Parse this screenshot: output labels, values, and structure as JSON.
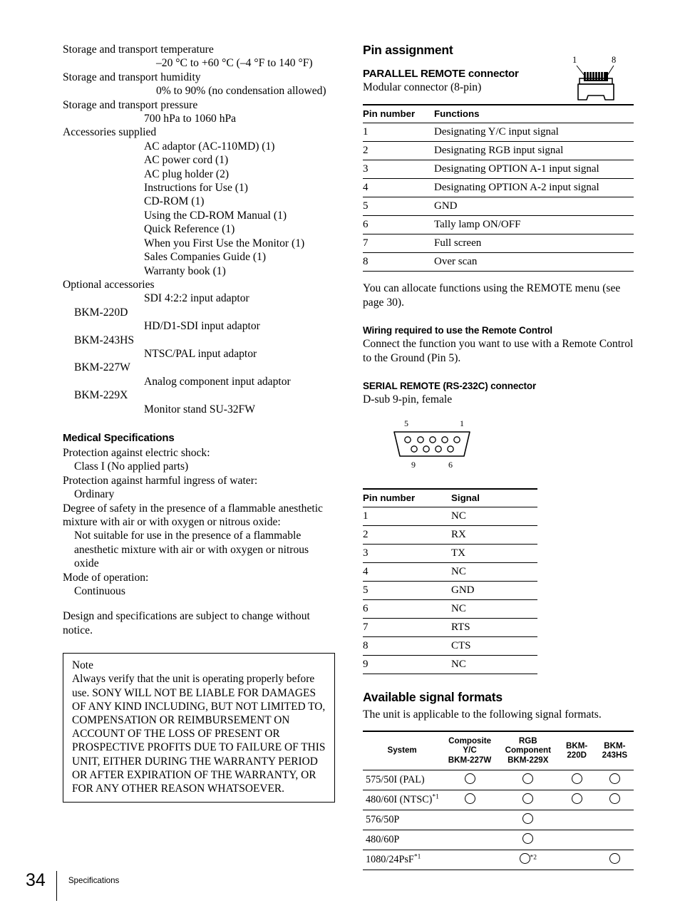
{
  "page": {
    "number": "34",
    "chapter": "Specifications"
  },
  "left_column": {
    "spec_items": [
      {
        "label": "Storage and transport temperature",
        "values": [
          "–20 °C to +60 °C (–4 °F to 140 °F)"
        ]
      },
      {
        "label": "Storage and transport humidity",
        "values": [
          "0% to 90% (no condensation allowed)"
        ]
      },
      {
        "label": "Storage and transport pressure",
        "values": [
          "700 hPa to 1060 hPa"
        ]
      },
      {
        "label": "Accessories supplied",
        "values": [
          "AC adaptor (AC-110MD) (1)",
          "AC power cord (1)",
          "AC plug holder (2)",
          "Instructions for Use (1)",
          "CD-ROM (1)",
          "Using the CD-ROM Manual (1)",
          "Quick Reference (1)",
          "When you First Use the Monitor (1)",
          "Sales Companies Guide (1)",
          "Warranty book (1)"
        ]
      },
      {
        "label": "Optional accessories",
        "values": [
          "SDI 4:2:2 input adaptor",
          "BKM-220D",
          "HD/D1-SDI input adaptor",
          "BKM-243HS",
          "NTSC/PAL input adaptor",
          "BKM-227W",
          "Analog component input adaptor",
          "BKM-229X",
          "Monitor stand SU-32FW"
        ]
      }
    ],
    "medical": {
      "heading": "Medical Specifications",
      "entries": [
        {
          "label": "Protection against electric shock:",
          "value": "Class I (No applied parts)"
        },
        {
          "label": "Protection against harmful ingress of water:",
          "value": "Ordinary"
        },
        {
          "label": "Degree of safety in the presence of a flammable anesthetic mixture with air or with oxygen or nitrous oxide:",
          "value": "Not suitable for use in the presence of a flammable anesthetic mixture with air or with oxygen or nitrous oxide"
        },
        {
          "label": "Mode of operation:",
          "value": "Continuous"
        }
      ]
    },
    "disclaimer": "Design and specifications are subject to change without notice.",
    "note": {
      "title": "Note",
      "text": "Always verify that the unit is operating properly before use. SONY WILL NOT BE LIABLE FOR DAMAGES OF ANY KIND INCLUDING, BUT NOT LIMITED TO, COMPENSATION OR REIMBURSEMENT ON ACCOUNT OF THE LOSS OF PRESENT OR PROSPECTIVE PROFITS DUE TO FAILURE OF THIS UNIT, EITHER DURING THE WARRANTY PERIOD OR AFTER EXPIRATION OF THE WARRANTY, OR FOR ANY OTHER REASON WHATSOEVER."
    }
  },
  "right_column": {
    "pin_assignment_heading": "Pin assignment",
    "parallel_remote": {
      "heading": "PARALLEL REMOTE connector",
      "subtitle": "Modular connector (8-pin)",
      "diagram_labels": {
        "left": "1",
        "right": "8"
      },
      "table": {
        "headers": [
          "Pin number",
          "Functions"
        ],
        "rows": [
          [
            "1",
            "Designating Y/C input signal"
          ],
          [
            "2",
            "Designating RGB input signal"
          ],
          [
            "3",
            "Designating OPTION A-1 input signal"
          ],
          [
            "4",
            "Designating OPTION A-2 input signal"
          ],
          [
            "5",
            "GND"
          ],
          [
            "6",
            "Tally lamp ON/OFF"
          ],
          [
            "7",
            "Full screen"
          ],
          [
            "8",
            "Over scan"
          ]
        ]
      },
      "note_after": "You can allocate functions using the REMOTE menu (see page 30)."
    },
    "wiring": {
      "heading": "Wiring required to use the Remote Control",
      "text": "Connect the function you want to use with a Remote Control to the Ground (Pin 5)."
    },
    "serial_remote": {
      "heading": "SERIAL REMOTE (RS-232C) connector",
      "subtitle": "D-sub 9-pin, female",
      "diagram_labels": {
        "top_left": "5",
        "top_right": "1",
        "bottom_left": "9",
        "bottom_right": "6"
      },
      "table": {
        "headers": [
          "Pin number",
          "Signal"
        ],
        "rows": [
          [
            "1",
            "NC"
          ],
          [
            "2",
            "RX"
          ],
          [
            "3",
            "TX"
          ],
          [
            "4",
            "NC"
          ],
          [
            "5",
            "GND"
          ],
          [
            "6",
            "NC"
          ],
          [
            "7",
            "RTS"
          ],
          [
            "8",
            "CTS"
          ],
          [
            "9",
            "NC"
          ]
        ]
      }
    },
    "signal_formats": {
      "heading": "Available signal formats",
      "intro": "The unit is applicable to the following signal formats.",
      "table": {
        "headers": [
          {
            "lines": [
              "System"
            ]
          },
          {
            "lines": [
              "Composite",
              "Y/C",
              "BKM-227W"
            ]
          },
          {
            "lines": [
              "RGB",
              "Component",
              "BKM-229X"
            ]
          },
          {
            "lines": [
              "BKM-",
              "220D"
            ]
          },
          {
            "lines": [
              "BKM-",
              "243HS"
            ]
          }
        ],
        "rows": [
          {
            "system": "575/50I (PAL)",
            "system_sup": "",
            "cells": [
              {
                "mark": true,
                "sup": ""
              },
              {
                "mark": true,
                "sup": ""
              },
              {
                "mark": true,
                "sup": ""
              },
              {
                "mark": true,
                "sup": ""
              }
            ]
          },
          {
            "system": "480/60I (NTSC)",
            "system_sup": "*1",
            "cells": [
              {
                "mark": true,
                "sup": ""
              },
              {
                "mark": true,
                "sup": ""
              },
              {
                "mark": true,
                "sup": ""
              },
              {
                "mark": true,
                "sup": ""
              }
            ]
          },
          {
            "system": "576/50P",
            "system_sup": "",
            "cells": [
              {
                "mark": false,
                "sup": ""
              },
              {
                "mark": true,
                "sup": ""
              },
              {
                "mark": false,
                "sup": ""
              },
              {
                "mark": false,
                "sup": ""
              }
            ]
          },
          {
            "system": "480/60P",
            "system_sup": "",
            "cells": [
              {
                "mark": false,
                "sup": ""
              },
              {
                "mark": true,
                "sup": ""
              },
              {
                "mark": false,
                "sup": ""
              },
              {
                "mark": false,
                "sup": ""
              }
            ]
          },
          {
            "system": "1080/24PsF",
            "system_sup": "*1",
            "cells": [
              {
                "mark": false,
                "sup": ""
              },
              {
                "mark": true,
                "sup": "*2"
              },
              {
                "mark": false,
                "sup": ""
              },
              {
                "mark": true,
                "sup": ""
              }
            ]
          }
        ]
      }
    }
  }
}
